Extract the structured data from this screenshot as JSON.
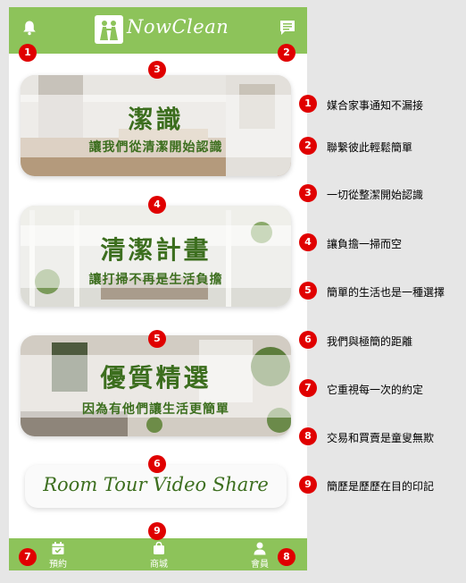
{
  "app": {
    "logo_text": "NowClean"
  },
  "cards": [
    {
      "title": "潔識",
      "subtitle": "讓我們從清潔開始認識"
    },
    {
      "title": "清潔計畫",
      "subtitle": "讓打掃不再是生活負擔"
    },
    {
      "title": "優質精選",
      "subtitle": "因為有他們讓生活更簡單"
    }
  ],
  "video_banner": {
    "label": "Room Tour Video Share"
  },
  "bottom_nav": {
    "booking_label": "預約",
    "shop_label": "商城",
    "member_label": "會員"
  },
  "badges": {
    "b1": "1",
    "b2": "2",
    "b3": "3",
    "b4": "4",
    "b5": "5",
    "b6": "6",
    "b7": "7",
    "b8": "8",
    "b9": "9"
  },
  "legend": [
    {
      "num": "1",
      "text": "媒合家事通知不漏接"
    },
    {
      "num": "2",
      "text": "聯繫彼此輕鬆簡單"
    },
    {
      "num": "3",
      "text": "一切從整潔開始認識"
    },
    {
      "num": "4",
      "text": "讓負擔一掃而空"
    },
    {
      "num": "5",
      "text": "簡單的生活也是一種選擇"
    },
    {
      "num": "6",
      "text": "我們與極簡的距離"
    },
    {
      "num": "7",
      "text": "它重視每一次的約定"
    },
    {
      "num": "8",
      "text": "交易和買賣是童叟無欺"
    },
    {
      "num": "9",
      "text": "簡歷是歷歷在目的印記"
    }
  ],
  "colors": {
    "brand_green": "#8dc35a",
    "title_green": "#3c6e1e",
    "badge_red": "#e00000"
  },
  "icons": [
    "bell-icon",
    "chat-icon",
    "logo-icon",
    "calendar-icon",
    "shop-bag-icon",
    "user-icon"
  ]
}
